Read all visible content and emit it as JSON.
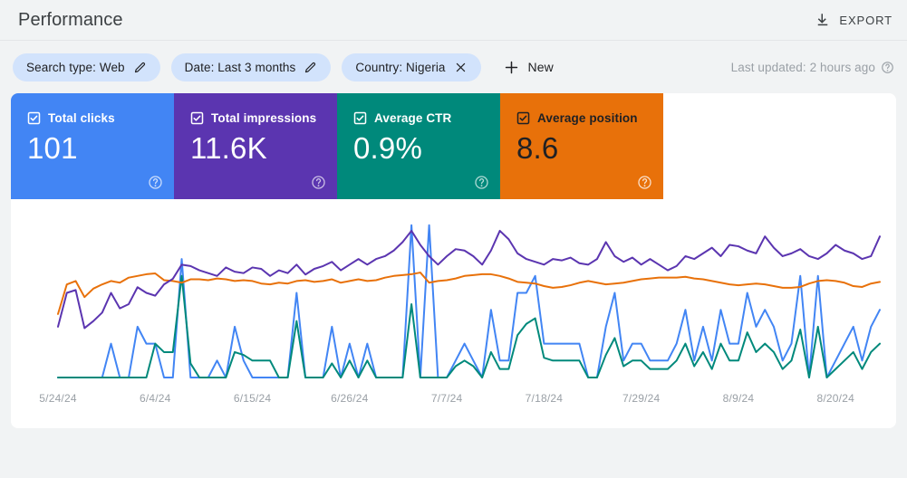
{
  "header": {
    "title": "Performance",
    "export_label": "EXPORT",
    "export_icon": "download-icon"
  },
  "filters": {
    "chips": [
      {
        "label": "Search type: Web",
        "icon": "pencil-icon",
        "action": "edit"
      },
      {
        "label": "Date: Last 3 months",
        "icon": "pencil-icon",
        "action": "edit"
      },
      {
        "label": "Country: Nigeria",
        "icon": "close-icon",
        "action": "remove"
      }
    ],
    "new_label": "New",
    "new_icon": "plus-icon",
    "last_updated": "Last updated: 2 hours ago",
    "last_updated_icon": "help-icon"
  },
  "metrics": [
    {
      "name": "Total clicks",
      "value": "101",
      "color": "#4285f4",
      "text_tone": "light",
      "checked": true,
      "check_icon": "checkbox-checked-icon",
      "help_icon": "help-icon"
    },
    {
      "name": "Total impressions",
      "value": "11.6K",
      "color": "#5b35b0",
      "text_tone": "light",
      "checked": true,
      "check_icon": "checkbox-checked-icon",
      "help_icon": "help-icon"
    },
    {
      "name": "Average CTR",
      "value": "0.9%",
      "color": "#00897b",
      "text_tone": "light",
      "checked": true,
      "check_icon": "checkbox-checked-icon",
      "help_icon": "help-icon"
    },
    {
      "name": "Average position",
      "value": "8.6",
      "color": "#e8710a",
      "text_tone": "dark",
      "checked": true,
      "check_icon": "checkbox-checked-icon",
      "help_icon": "help-icon"
    }
  ],
  "chart_data": {
    "type": "line",
    "title": "",
    "xlabel": "",
    "ylabel": "",
    "grid": false,
    "legend": "metric-tiles-above",
    "x_tick_labels": [
      "5/24/24",
      "6/4/24",
      "6/15/24",
      "6/26/24",
      "7/7/24",
      "7/18/24",
      "7/29/24",
      "8/9/24",
      "8/20/24"
    ],
    "x_tick_indices": [
      0,
      11,
      22,
      33,
      44,
      55,
      66,
      77,
      88
    ],
    "n_points": 94,
    "series": [
      {
        "name": "Total clicks",
        "color": "#4285f4",
        "ylim": [
          0,
          10
        ],
        "values": [
          0,
          0,
          0,
          0,
          0,
          0,
          2,
          0,
          0,
          3,
          2,
          2,
          0,
          0,
          7,
          0,
          0,
          0,
          1,
          0,
          3,
          1,
          0,
          0,
          0,
          0,
          0,
          5,
          0,
          0,
          0,
          3,
          0,
          2,
          0,
          2,
          0,
          0,
          0,
          0,
          9,
          0,
          9,
          0,
          0,
          1,
          2,
          1,
          0,
          4,
          1,
          1,
          5,
          5,
          6,
          2,
          2,
          2,
          2,
          2,
          0,
          0,
          3,
          5,
          1,
          2,
          2,
          1,
          1,
          1,
          2,
          4,
          1,
          3,
          1,
          4,
          2,
          2,
          5,
          3,
          4,
          3,
          1,
          2,
          6,
          0,
          6,
          0,
          1,
          2,
          3,
          1,
          3,
          4
        ]
      },
      {
        "name": "Total impressions",
        "color": "#5b35b0",
        "ylim": [
          0,
          600
        ],
        "values": [
          180,
          300,
          310,
          175,
          200,
          230,
          300,
          245,
          260,
          320,
          300,
          290,
          330,
          350,
          400,
          395,
          380,
          370,
          360,
          390,
          375,
          370,
          390,
          385,
          360,
          380,
          370,
          400,
          365,
          385,
          395,
          410,
          380,
          400,
          420,
          400,
          420,
          430,
          450,
          480,
          520,
          470,
          430,
          400,
          430,
          455,
          450,
          430,
          400,
          450,
          520,
          490,
          440,
          420,
          410,
          400,
          420,
          415,
          425,
          405,
          400,
          420,
          480,
          430,
          410,
          425,
          400,
          420,
          400,
          380,
          395,
          430,
          420,
          440,
          460,
          430,
          470,
          465,
          450,
          440,
          500,
          460,
          430,
          440,
          455,
          430,
          420,
          440,
          470,
          450,
          440,
          420,
          430,
          500
        ]
      },
      {
        "name": "Average CTR",
        "color": "#00897b",
        "ylim": [
          0,
          6
        ],
        "values": [
          0,
          0,
          0,
          0,
          0,
          0,
          0,
          0,
          0,
          0,
          0,
          1.2,
          0.9,
          0.9,
          3.6,
          0.5,
          0,
          0,
          0,
          0,
          0.9,
          0.8,
          0.6,
          0.6,
          0.6,
          0,
          0,
          2.0,
          0,
          0,
          0,
          0.5,
          0,
          0.6,
          0,
          0.6,
          0,
          0,
          0,
          0,
          2.6,
          0,
          0,
          0,
          0,
          0.4,
          0.6,
          0.4,
          0,
          0.9,
          0.3,
          0.3,
          1.5,
          1.9,
          2.1,
          0.7,
          0.6,
          0.6,
          0.6,
          0.6,
          0,
          0,
          0.8,
          1.4,
          0.4,
          0.6,
          0.6,
          0.3,
          0.3,
          0.3,
          0.6,
          1.2,
          0.4,
          0.9,
          0.3,
          1.2,
          0.6,
          0.6,
          1.6,
          0.9,
          1.2,
          0.9,
          0.3,
          0.6,
          1.7,
          0,
          1.8,
          0,
          0.3,
          0.6,
          0.9,
          0.3,
          0.9,
          1.2
        ]
      },
      {
        "name": "Average position",
        "color": "#e8710a",
        "ylim": [
          0,
          20
        ],
        "inverted": true,
        "values": [
          12.5,
          9.0,
          8.6,
          10.5,
          9.5,
          9.0,
          8.6,
          8.8,
          8.2,
          8.0,
          7.8,
          7.7,
          8.5,
          8.6,
          8.8,
          8.4,
          8.4,
          8.5,
          8.3,
          8.4,
          8.6,
          8.5,
          8.6,
          8.9,
          9.0,
          8.8,
          8.9,
          8.6,
          8.5,
          8.7,
          8.6,
          8.4,
          8.8,
          8.6,
          8.4,
          8.6,
          8.5,
          8.2,
          8.0,
          7.9,
          7.8,
          7.6,
          8.8,
          8.6,
          8.5,
          8.3,
          8.0,
          7.9,
          7.8,
          7.8,
          8.0,
          8.3,
          8.7,
          8.8,
          8.9,
          9.2,
          9.4,
          9.3,
          9.1,
          8.8,
          8.6,
          8.8,
          9.0,
          8.9,
          8.8,
          8.6,
          8.4,
          8.3,
          8.2,
          8.2,
          8.2,
          8.1,
          8.3,
          8.4,
          8.6,
          8.8,
          9.0,
          9.1,
          9.0,
          8.9,
          9.0,
          9.2,
          9.4,
          9.4,
          9.3,
          8.9,
          8.6,
          8.5,
          8.6,
          8.8,
          9.2,
          9.3,
          8.9,
          8.7
        ]
      }
    ]
  }
}
